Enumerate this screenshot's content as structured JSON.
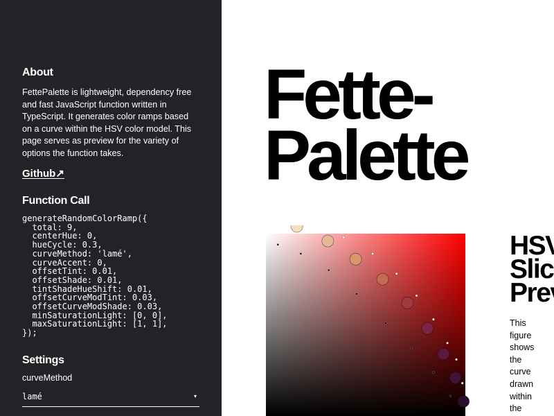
{
  "sidebar": {
    "about_heading": "About",
    "about_text": "FettePalette is lightweight, dependency free and fast JavaScript function written in TypeScript. It generates color ramps based on a curve within the HSV color model. This page serves as preview for the variety of options the function takes.",
    "github_label": "Github↗",
    "function_heading": "Function Call",
    "code": "generateRandomColorRamp({\n  total: 9,\n  centerHue: 0,\n  hueCycle: 0.3,\n  curveMethod: 'lamé',\n  curveAccent: 0,\n  offsetTint: 0.01,\n  offsetShade: 0.01,\n  tintShadeHueShift: 0.01,\n  offsetCurveModTint: 0.03,\n  offsetCurveModShade: 0.03,\n  minSaturationLight: [0, 0],\n  maxSaturationLight: [1, 1],\n});",
    "settings_heading": "Settings",
    "setting_label": "curveMethod",
    "setting_value": "lamé",
    "setting_arrow": "▾"
  },
  "main": {
    "title_line1": "Fette-",
    "title_line2": "Palette",
    "hsv_title_line1": "HSV",
    "hsv_title_line2": "Slic",
    "hsv_title_line3": "Prev",
    "hsv_desc": "This figure shows the curve drawn within the"
  },
  "plot": {
    "hue_color": "#ff0000",
    "swatches": [
      {
        "s": 0.155,
        "v": 1.04,
        "color": "#f6dfc0"
      },
      {
        "s": 0.31,
        "v": 0.96,
        "color": "#e6b996"
      },
      {
        "s": 0.45,
        "v": 0.86,
        "color": "#d9996c"
      },
      {
        "s": 0.585,
        "v": 0.75,
        "color": "#c66a52"
      },
      {
        "s": 0.71,
        "v": 0.62,
        "color": "#9e3a40"
      },
      {
        "s": 0.81,
        "v": 0.48,
        "color": "#7a2541"
      },
      {
        "s": 0.89,
        "v": 0.34,
        "color": "#5a1a40"
      },
      {
        "s": 0.95,
        "v": 0.21,
        "color": "#3f1238"
      },
      {
        "s": 0.99,
        "v": 0.08,
        "color": "#2a0c2c"
      }
    ],
    "tint_dots": [
      {
        "s": 0.23,
        "v": 1.06
      },
      {
        "s": 0.39,
        "v": 0.98
      },
      {
        "s": 0.535,
        "v": 0.89
      },
      {
        "s": 0.655,
        "v": 0.78
      },
      {
        "s": 0.755,
        "v": 0.66
      },
      {
        "s": 0.84,
        "v": 0.53
      },
      {
        "s": 0.91,
        "v": 0.4
      },
      {
        "s": 0.955,
        "v": 0.31
      },
      {
        "s": 0.985,
        "v": 0.18
      }
    ],
    "shade_dots": [
      {
        "s": 0.06,
        "v": 0.94
      },
      {
        "s": 0.175,
        "v": 0.89
      },
      {
        "s": 0.315,
        "v": 0.8
      },
      {
        "s": 0.455,
        "v": 0.67
      },
      {
        "s": 0.6,
        "v": 0.51
      },
      {
        "s": 0.73,
        "v": 0.37
      },
      {
        "s": 0.84,
        "v": 0.24
      },
      {
        "s": 0.925,
        "v": 0.11
      }
    ]
  }
}
